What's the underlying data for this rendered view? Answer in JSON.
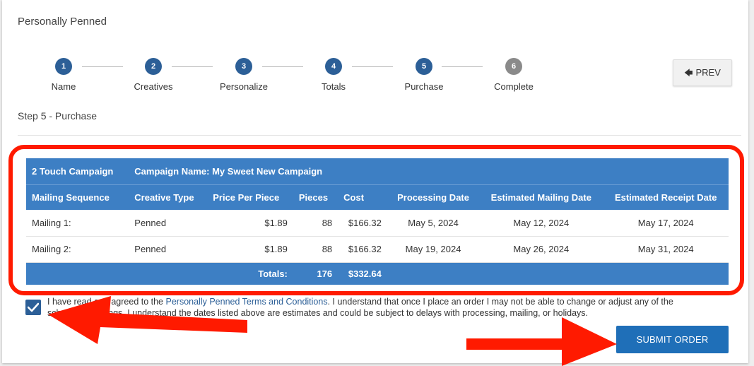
{
  "app": {
    "title": "Personally Penned"
  },
  "stepper": {
    "steps": [
      {
        "number": "1",
        "label": "Name",
        "state": "done"
      },
      {
        "number": "2",
        "label": "Creatives",
        "state": "done"
      },
      {
        "number": "3",
        "label": "Personalize",
        "state": "done"
      },
      {
        "number": "4",
        "label": "Totals",
        "state": "done"
      },
      {
        "number": "5",
        "label": "Purchase",
        "state": "current"
      },
      {
        "number": "6",
        "label": "Complete",
        "state": "upcoming"
      }
    ]
  },
  "nav": {
    "prev_label": "PREV",
    "prev_icon": "arrow-left-icon"
  },
  "step_heading": "Step 5 - Purchase",
  "campaign": {
    "title": "2 Touch Campaign",
    "name_label": "Campaign Name: My Sweet New Campaign"
  },
  "table": {
    "headers": [
      "Mailing Sequence",
      "Creative Type",
      "Price Per Piece",
      "Pieces",
      "Cost",
      "Processing Date",
      "Estimated Mailing Date",
      "Estimated Receipt Date"
    ],
    "rows": [
      [
        "Mailing 1:",
        "Penned",
        "$1.89",
        "88",
        "$166.32",
        "May 5, 2024",
        "May 12, 2024",
        "May 17, 2024"
      ],
      [
        "Mailing 2:",
        "Penned",
        "$1.89",
        "88",
        "$166.32",
        "May 19, 2024",
        "May 26, 2024",
        "May 31, 2024"
      ]
    ],
    "totals": {
      "label": "Totals:",
      "pieces": "176",
      "cost": "$332.64"
    }
  },
  "agreement": {
    "checked": true,
    "text_before": "I have read and agreed to the ",
    "link_text": "Personally Penned Terms and Conditions",
    "text_after": ". I understand that once I place an order I may not be able to change or adjust any of the scheduled mailings. I understand the dates listed above are estimates and could be subject to delays with processing, mailing, or holidays."
  },
  "submit_label": "SUBMIT ORDER",
  "colors": {
    "step_active": "#2c5f97",
    "step_inactive": "#8a8a8a",
    "table_header": "#3d7fc4",
    "submit_button": "#1f6fb8",
    "annotation": "#ff1a00"
  }
}
